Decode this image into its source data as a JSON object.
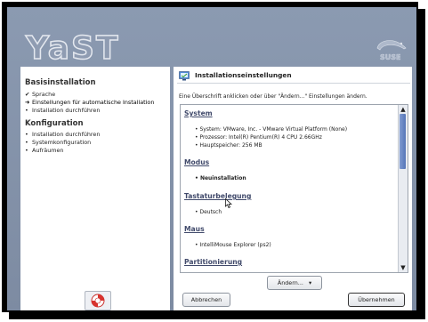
{
  "branding": {
    "yast_logo": "YaST",
    "suse_logo": "SUSE"
  },
  "sidebar": {
    "sections": [
      {
        "title": "Basisinstallation",
        "items": [
          {
            "marker": "✔",
            "label": "Sprache"
          },
          {
            "marker": "➜",
            "label": "Einstellungen für automatische Installation"
          },
          {
            "marker": "•",
            "label": "Installation durchführen"
          }
        ]
      },
      {
        "title": "Konfiguration",
        "items": [
          {
            "marker": "•",
            "label": "Installation durchführen"
          },
          {
            "marker": "•",
            "label": "Systemkonfiguration"
          },
          {
            "marker": "•",
            "label": "Aufräumen"
          }
        ]
      }
    ]
  },
  "dialog": {
    "title": "Installationseinstellungen",
    "instruction": "Eine Überschrift anklicken oder über \"Ändern...\" Einstellungen ändern.",
    "summary": [
      {
        "heading": "System",
        "items": [
          "System: VMware, Inc. - VMware Virtual Platform (None)",
          "Prozessor: Intel(R) Pentium(R) 4 CPU 2.66GHz",
          "Hauptspeicher: 256 MB"
        ]
      },
      {
        "heading": "Modus",
        "items": [
          "Neuinstallation"
        ]
      },
      {
        "heading": "Tastaturbelegung",
        "items": [
          "Deutsch"
        ]
      },
      {
        "heading": "Maus",
        "items": [
          "IntelliMouse Explorer (ps2)"
        ]
      },
      {
        "heading": "Partitionierung",
        "items": []
      }
    ],
    "change_button": "Ändern...",
    "cancel_button": "Abbrechen",
    "accept_button": "Übernehmen"
  },
  "colors": {
    "accent": "#5575b8",
    "heading": "#414a6b",
    "background": "#8b9ab1"
  }
}
